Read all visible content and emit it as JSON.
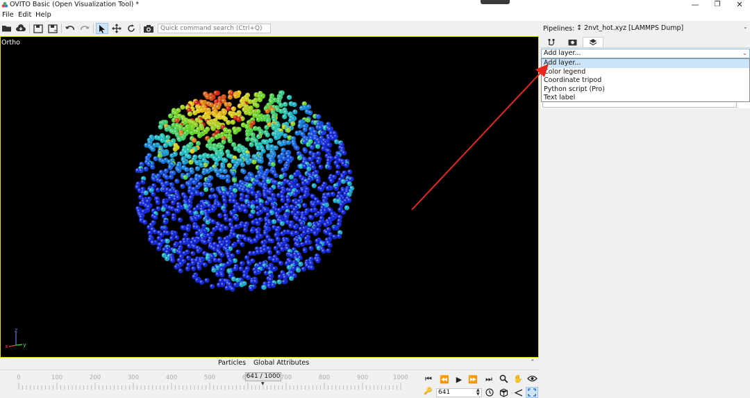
{
  "app": {
    "title": "OVITO Basic (Open Visualization Tool) *",
    "menu": [
      "File",
      "Edit",
      "Help"
    ],
    "window_controls": [
      "—",
      "❐",
      "✕"
    ]
  },
  "toolbar": {
    "search_placeholder": "Quick command search (Ctrl+Q)",
    "icons": [
      "open-file-icon",
      "cloud-load-icon",
      "save-icon",
      "save-as-icon",
      "undo-icon",
      "redo-icon",
      "select-mode-icon",
      "move-mode-icon",
      "rotate-mode-icon",
      "render-icon"
    ]
  },
  "viewport": {
    "label": "Ortho",
    "axis_labels": {
      "z": "z",
      "x": "x",
      "y": "y"
    }
  },
  "right_panel": {
    "pipelines_label": "Pipelines:",
    "pipeline_name": "2nvt_hot.xyz [LAMMPS Dump]",
    "tab_icons": [
      "pipeline-tab-icon",
      "render-tab-icon",
      "layers-tab-icon"
    ],
    "add_layer_combo": "Add layer...",
    "dropdown_items": [
      "Add layer...",
      "Color legend",
      "Coordinate tripod",
      "Python script (Pro)",
      "Text label"
    ],
    "selected_index": 0
  },
  "bottom": {
    "tabs": [
      "Particles",
      "Global Attributes"
    ],
    "tick_labels": [
      "0",
      "100",
      "200",
      "300",
      "400",
      "500",
      "600",
      "700",
      "800",
      "900",
      "1000"
    ],
    "frame_indicator": "641 / 1000",
    "frame_value": "641",
    "current_frame": 641,
    "max_frame": 1000
  },
  "colors": {
    "viewport_bg": "#000000",
    "viewport_border": "#e6e600",
    "accent_selection": "#cce4f7",
    "annotation_arrow": "#e8251f"
  }
}
